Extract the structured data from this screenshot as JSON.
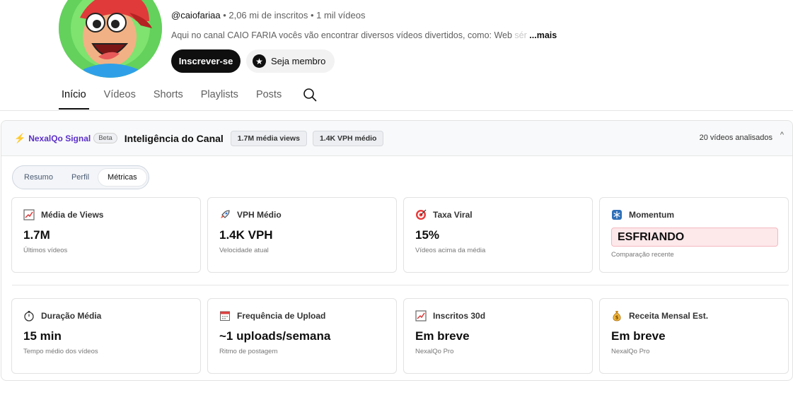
{
  "channel": {
    "handle": "@caiofariaa",
    "stats": " • 2,06 mi de inscritos • 1 mil vídeos",
    "description": "Aqui no canal CAIO FARIA vocês vão encontrar diversos vídeos divertidos, como: Web ",
    "description_faded": "sér",
    "more_label": "...mais",
    "subscribe_label": "Inscrever-se",
    "member_label": "Seja membro"
  },
  "tabs": [
    {
      "label": "Início",
      "active": true
    },
    {
      "label": "Vídeos"
    },
    {
      "label": "Shorts"
    },
    {
      "label": "Playlists"
    },
    {
      "label": "Posts"
    }
  ],
  "widget": {
    "brand": "NexalQo Signal",
    "beta": "Beta",
    "title": "Inteligência do Canal",
    "chip_views": "1.7M média views",
    "chip_vph": "1.4K VPH médio",
    "analyzed": "20 vídeos analisados",
    "caret": "^",
    "segments": [
      "Resumo",
      "Perfil",
      "Métricas"
    ],
    "cards": [
      {
        "icon": "chart-up-icon",
        "title": "Média de Views",
        "value": "1.7M",
        "sub": "Últimos vídeos"
      },
      {
        "icon": "rocket-icon",
        "title": "VPH Médio",
        "value": "1.4K VPH",
        "sub": "Velocidade atual"
      },
      {
        "icon": "target-icon",
        "title": "Taxa Viral",
        "value": "15%",
        "sub": "Vídeos acima da média"
      },
      {
        "icon": "snowflake-icon",
        "title": "Momentum",
        "value": "ESFRIANDO",
        "sub": "Comparação recente"
      },
      {
        "icon": "stopwatch-icon",
        "title": "Duração Média",
        "value": "15 min",
        "sub": "Tempo médio dos vídeos"
      },
      {
        "icon": "calendar-icon",
        "title": "Frequência de Upload",
        "value": "~1 uploads/semana",
        "sub": "Ritmo de postagem"
      },
      {
        "icon": "chart-up-icon",
        "title": "Inscritos 30d",
        "value": "Em breve",
        "sub": "NexalQo Pro"
      },
      {
        "icon": "money-bag-icon",
        "title": "Receita Mensal Est.",
        "value": "Em breve",
        "sub": "NexalQo Pro"
      }
    ]
  },
  "colors": {
    "brand": "#5b2fc9",
    "cold_badge": "#fde8ea"
  }
}
